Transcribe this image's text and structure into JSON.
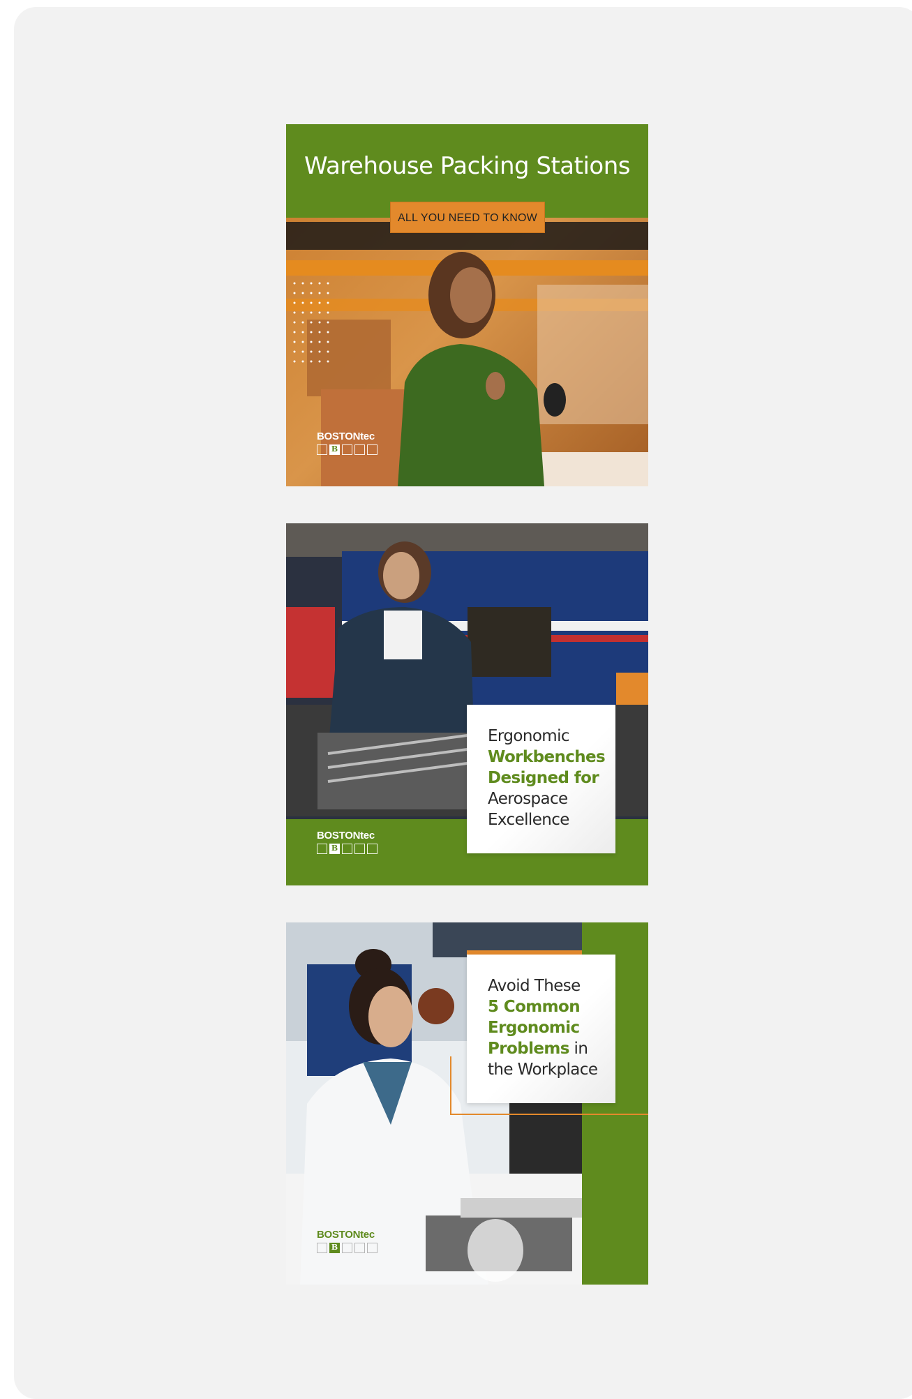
{
  "cards": [
    {
      "title": "Warehouse Packing Stations",
      "badge": "ALL YOU NEED TO KNOW",
      "logo": {
        "text": "BOSTONtec",
        "mark": "B"
      }
    },
    {
      "lines": [
        {
          "text": "Ergonomic",
          "highlight": false
        },
        {
          "text": "Workbenches",
          "highlight": true
        },
        {
          "text": "Designed for",
          "highlight": true
        },
        {
          "text": "Aerospace",
          "highlight": false
        },
        {
          "text": "Excellence",
          "highlight": false
        }
      ],
      "logo": {
        "text": "BOSTONtec",
        "mark": "B"
      }
    },
    {
      "line1": "Avoid These",
      "line2": "5 Common",
      "line3": "Ergonomic",
      "line4_highlight": "Problems",
      "line4_rest": " in",
      "line5": "the Workplace",
      "logo": {
        "text": "BOSTONtec",
        "mark": "B"
      }
    }
  ],
  "colors": {
    "brand_green": "#5f8b1e",
    "accent_orange": "#e3892c",
    "page_panel": "#f2f2f2"
  }
}
